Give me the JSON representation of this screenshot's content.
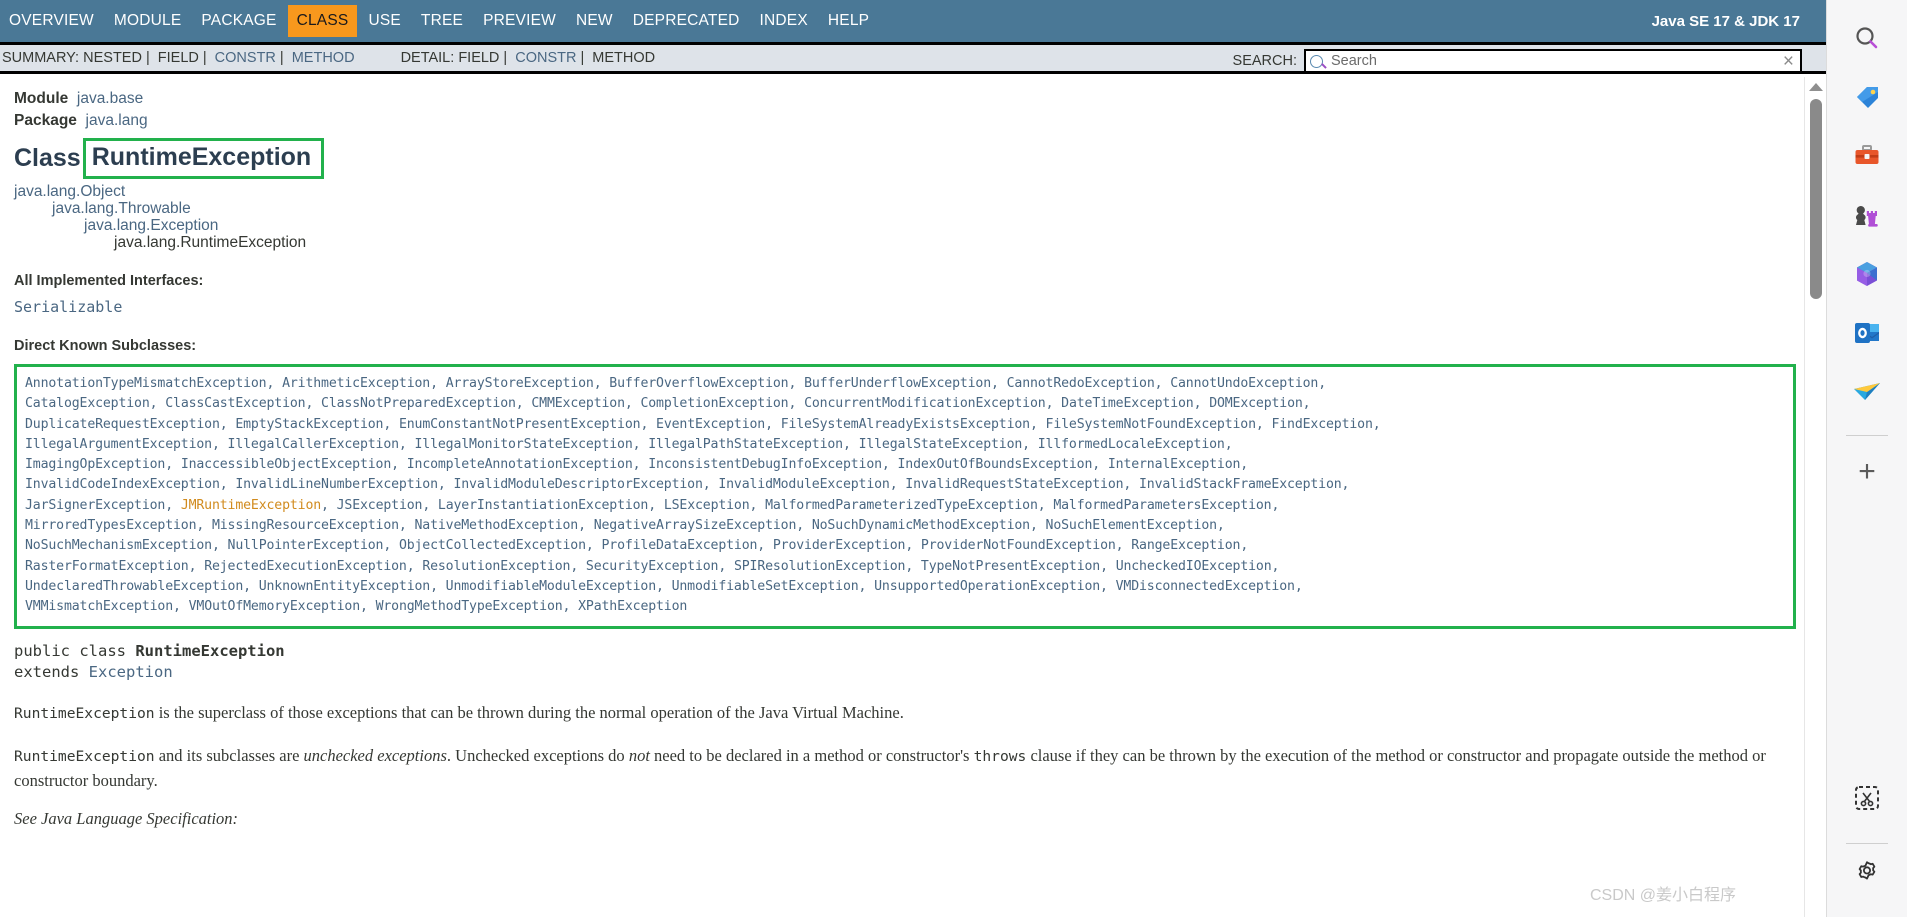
{
  "topnav": {
    "items": [
      {
        "label": "OVERVIEW",
        "active": false
      },
      {
        "label": "MODULE",
        "active": false
      },
      {
        "label": "PACKAGE",
        "active": false
      },
      {
        "label": "CLASS",
        "active": true
      },
      {
        "label": "USE",
        "active": false
      },
      {
        "label": "TREE",
        "active": false
      },
      {
        "label": "PREVIEW",
        "active": false
      },
      {
        "label": "NEW",
        "active": false
      },
      {
        "label": "DEPRECATED",
        "active": false
      },
      {
        "label": "INDEX",
        "active": false
      },
      {
        "label": "HELP",
        "active": false
      }
    ],
    "release": "Java SE 17 & JDK 17"
  },
  "subnav": {
    "summary_label": "SUMMARY:",
    "summary_items": [
      "NESTED",
      "FIELD",
      "CONSTR",
      "METHOD"
    ],
    "summary_links": [
      false,
      false,
      true,
      true
    ],
    "detail_label": "DETAIL:",
    "detail_items": [
      "FIELD",
      "CONSTR",
      "METHOD"
    ],
    "detail_links": [
      false,
      true,
      false
    ],
    "search_label": "SEARCH:",
    "search_placeholder": "Search",
    "search_value": "",
    "reset_icon": "×"
  },
  "header": {
    "module_label": "Module",
    "module_name": "java.base",
    "package_label": "Package",
    "package_name": "java.lang",
    "class_keyword": "Class",
    "class_name": "RuntimeException",
    "highlight_color": "#22b14c"
  },
  "inheritance": [
    "java.lang.Object",
    "java.lang.Throwable",
    "java.lang.Exception",
    "java.lang.RuntimeException"
  ],
  "interfaces": {
    "heading": "All Implemented Interfaces:",
    "items": [
      "Serializable"
    ]
  },
  "subclasses": {
    "heading": "Direct Known Subclasses:",
    "lines": [
      [
        "AnnotationTypeMismatchException",
        "ArithmeticException",
        "ArrayStoreException",
        "BufferOverflowException",
        "BufferUnderflowException",
        "CannotRedoException",
        "CannotUndoException"
      ],
      [
        "CatalogException",
        "ClassCastException",
        "ClassNotPreparedException",
        "CMMException",
        "CompletionException",
        "ConcurrentModificationException",
        "DateTimeException",
        "DOMException"
      ],
      [
        "DuplicateRequestException",
        "EmptyStackException",
        "EnumConstantNotPresentException",
        "EventException",
        "FileSystemAlreadyExistsException",
        "FileSystemNotFoundException",
        "FindException"
      ],
      [
        "IllegalArgumentException",
        "IllegalCallerException",
        "IllegalMonitorStateException",
        "IllegalPathStateException",
        "IllegalStateException",
        "IllformedLocaleException"
      ],
      [
        "ImagingOpException",
        "InaccessibleObjectException",
        "IncompleteAnnotationException",
        "InconsistentDebugInfoException",
        "IndexOutOfBoundsException",
        "InternalException"
      ],
      [
        "InvalidCodeIndexException",
        "InvalidLineNumberException",
        "InvalidModuleDescriptorException",
        "InvalidModuleException",
        "InvalidRequestStateException",
        "InvalidStackFrameException"
      ],
      [
        "JarSignerException",
        "JMRuntimeException",
        "JSException",
        "LayerInstantiationException",
        "LSException",
        "MalformedParameterizedTypeException",
        "MalformedParametersException"
      ],
      [
        "MirroredTypesException",
        "MissingResourceException",
        "NativeMethodException",
        "NegativeArraySizeException",
        "NoSuchDynamicMethodException",
        "NoSuchElementException"
      ],
      [
        "NoSuchMechanismException",
        "NullPointerException",
        "ObjectCollectedException",
        "ProfileDataException",
        "ProviderException",
        "ProviderNotFoundException",
        "RangeException"
      ],
      [
        "RasterFormatException",
        "RejectedExecutionException",
        "ResolutionException",
        "SecurityException",
        "SPIResolutionException",
        "TypeNotPresentException",
        "UncheckedIOException"
      ],
      [
        "UndeclaredThrowableException",
        "UnknownEntityException",
        "UnmodifiableModuleException",
        "UnmodifiableSetException",
        "UnsupportedOperationException",
        "VMDisconnectedException"
      ],
      [
        "VMMismatchException",
        "VMOutOfMemoryException",
        "WrongMethodTypeException",
        "XPathException"
      ]
    ],
    "visited": [
      "JMRuntimeException"
    ],
    "last_line_index": 11,
    "link_color": "#4a6782",
    "visited_color": "#d18b1e"
  },
  "declaration": {
    "modifiers": "public class",
    "name": "RuntimeException",
    "extends_keyword": "extends",
    "superclass": "Exception"
  },
  "description": {
    "p1_code": "RuntimeException",
    "p1_text": " is the superclass of those exceptions that can be thrown during the normal operation of the Java Virtual Machine.",
    "p2_code": "RuntimeException",
    "p2_a": " and its subclasses are ",
    "p2_i": "unchecked exceptions",
    "p2_b": ". Unchecked exceptions do ",
    "p2_i2": "not",
    "p2_c": " need to be declared in a method or constructor's ",
    "p2_code2": "throws",
    "p2_d": " clause if they can be thrown by the execution of the method or constructor and propagate outside the method or constructor boundary.",
    "see_spec": "See Java Language Specification:"
  },
  "sidebar": {
    "items": [
      {
        "name": "search-icon",
        "glyph": "search"
      },
      {
        "name": "tag-icon",
        "glyph": "tag"
      },
      {
        "name": "briefcase-icon",
        "glyph": "briefcase"
      },
      {
        "name": "chess-icon",
        "glyph": "chess"
      },
      {
        "name": "microsoft365-icon",
        "glyph": "m365"
      },
      {
        "name": "outlook-icon",
        "glyph": "outlook"
      },
      {
        "name": "paper-plane-icon",
        "glyph": "plane"
      }
    ],
    "add_label": "+",
    "snip_icon": "snip",
    "settings_icon": "gear"
  },
  "watermark": "CSDN @姜小白程序",
  "colors": {
    "navbar": "#4a7896",
    "active_tab": "#f8981d",
    "subnav_bg": "#dee3e9",
    "link": "#4a6782",
    "highlight": "#22b14c"
  }
}
